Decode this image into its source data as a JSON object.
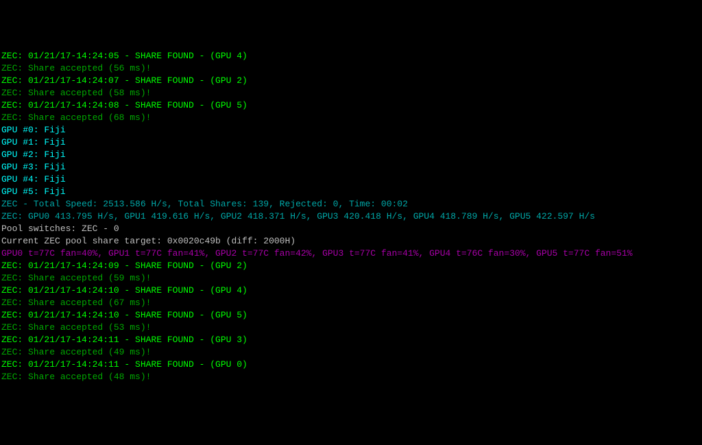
{
  "lines": [
    {
      "cls": "green-bright",
      "text": "ZEC: 01/21/17-14:24:05 - SHARE FOUND - (GPU 4)"
    },
    {
      "cls": "green-dark",
      "text": "ZEC: Share accepted (56 ms)!"
    },
    {
      "cls": "green-bright",
      "text": "ZEC: 01/21/17-14:24:07 - SHARE FOUND - (GPU 2)"
    },
    {
      "cls": "green-dark",
      "text": "ZEC: Share accepted (58 ms)!"
    },
    {
      "cls": "green-bright",
      "text": "ZEC: 01/21/17-14:24:08 - SHARE FOUND - (GPU 5)"
    },
    {
      "cls": "green-dark",
      "text": "ZEC: Share accepted (68 ms)!"
    },
    {
      "cls": "green-dark",
      "text": ""
    },
    {
      "cls": "cyan-bright",
      "text": "GPU #0: Fiji"
    },
    {
      "cls": "cyan-bright",
      "text": "GPU #1: Fiji"
    },
    {
      "cls": "cyan-bright",
      "text": "GPU #2: Fiji"
    },
    {
      "cls": "cyan-bright",
      "text": "GPU #3: Fiji"
    },
    {
      "cls": "cyan-bright",
      "text": "GPU #4: Fiji"
    },
    {
      "cls": "cyan-bright",
      "text": "GPU #5: Fiji"
    },
    {
      "cls": "cyan-dark",
      "text": "ZEC - Total Speed: 2513.586 H/s, Total Shares: 139, Rejected: 0, Time: 00:02"
    },
    {
      "cls": "cyan-dark",
      "text": "ZEC: GPU0 413.795 H/s, GPU1 419.616 H/s, GPU2 418.371 H/s, GPU3 420.418 H/s, GPU4 418.789 H/s, GPU5 422.597 H/s"
    },
    {
      "cls": "white",
      "text": "Pool switches: ZEC - 0"
    },
    {
      "cls": "white",
      "text": "Current ZEC pool share target: 0x0020c49b (diff: 2000H)"
    },
    {
      "cls": "magenta",
      "text": "GPU0 t=77C fan=40%, GPU1 t=77C fan=41%, GPU2 t=77C fan=42%, GPU3 t=77C fan=41%, GPU4 t=76C fan=30%, GPU5 t=77C fan=51%"
    },
    {
      "cls": "white",
      "text": ""
    },
    {
      "cls": "green-bright",
      "text": "ZEC: 01/21/17-14:24:09 - SHARE FOUND - (GPU 2)"
    },
    {
      "cls": "green-dark",
      "text": "ZEC: Share accepted (59 ms)!"
    },
    {
      "cls": "green-bright",
      "text": "ZEC: 01/21/17-14:24:10 - SHARE FOUND - (GPU 4)"
    },
    {
      "cls": "green-dark",
      "text": "ZEC: Share accepted (67 ms)!"
    },
    {
      "cls": "green-bright",
      "text": "ZEC: 01/21/17-14:24:10 - SHARE FOUND - (GPU 5)"
    },
    {
      "cls": "green-dark",
      "text": "ZEC: Share accepted (53 ms)!"
    },
    {
      "cls": "green-bright",
      "text": "ZEC: 01/21/17-14:24:11 - SHARE FOUND - (GPU 3)"
    },
    {
      "cls": "green-dark",
      "text": "ZEC: Share accepted (49 ms)!"
    },
    {
      "cls": "green-bright",
      "text": "ZEC: 01/21/17-14:24:11 - SHARE FOUND - (GPU 0)"
    },
    {
      "cls": "green-dark",
      "text": "ZEC: Share accepted (48 ms)!"
    }
  ]
}
